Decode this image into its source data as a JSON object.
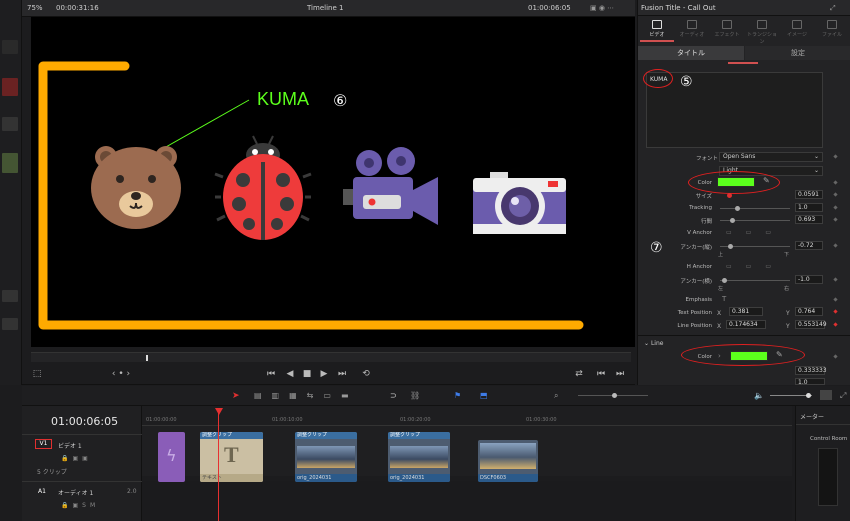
{
  "viewer_bar": {
    "zoom": "75%",
    "source_timecode": "00:00:31:16",
    "timeline_name": "Timeline 1",
    "record_timecode": "01:00:06:05"
  },
  "viewer": {
    "title_text": "KUMA",
    "annotation_number": "⑥"
  },
  "inspector": {
    "title": "Fusion Title - Call Out",
    "tabs": [
      "ビデオ",
      "オーディオ",
      "エフェクト",
      "トランジション",
      "イメージ",
      "ファイル"
    ],
    "sub_tabs": [
      "タイトル",
      "設定"
    ],
    "text_value": "KUMA",
    "annotation_text_number": "⑤",
    "annotation_params_number": "⑦",
    "font_label": "フォント",
    "font_value": "Open Sans",
    "style_value": "Light",
    "color_label": "Color",
    "size_label": "サイズ",
    "size_value": "0.0591",
    "tracking_label": "Tracking",
    "tracking_value": "1.0",
    "line_spacing_label": "行間",
    "line_spacing_value": "0.693",
    "v_anchor_label": "V Anchor",
    "anchor_v_label": "アンカー(縦)",
    "anchor_v_value": "-0.72",
    "anchor_v_left": "上",
    "anchor_v_right": "下",
    "h_anchor_label": "H Anchor",
    "anchor_h_label": "アンカー(横)",
    "anchor_h_value": "-1.0",
    "anchor_h_left": "左",
    "anchor_h_right": "右",
    "emphasis_label": "Emphasis",
    "text_position_label": "Text Position",
    "text_position_x": "0.381",
    "text_position_y": "0.764",
    "line_position_label": "Line Position",
    "line_position_x": "0.174634",
    "line_position_y": "0.553149",
    "x_label": "X",
    "y_label": "Y",
    "line_section": "Line",
    "line_color_label": "Color",
    "line_value_1": "0.333333",
    "line_value_2": "1.0"
  },
  "timeline": {
    "timecode": "01:00:06:05",
    "ruler_ticks": [
      "01:00:00:00",
      "01:00:10:00",
      "01:00:20:00",
      "01:00:30:00"
    ],
    "video_track_id": "V1",
    "video_track_name": "ビデオ 1",
    "video_track_clips": "5 クリップ",
    "audio_track_id": "A1",
    "audio_track_name": "オーディオ 1",
    "audio_track_level": "2.0",
    "clips": [
      {
        "label": "",
        "bottom": ""
      },
      {
        "label": "調整クリップ",
        "bottom": "テキスト"
      },
      {
        "label": "調整クリップ",
        "bottom": "orig_2024031"
      },
      {
        "label": "調整クリップ",
        "bottom": "orig_2024031"
      },
      {
        "label": "",
        "bottom": "DSCF0603"
      }
    ]
  },
  "mixer": {
    "title": "メーター",
    "control_room": "Control Room"
  },
  "colors": {
    "accent_orange": "#ffaa00",
    "title_green": "#5cff1c",
    "playhead_red": "#e63030",
    "annotation_red": "#e02020"
  }
}
